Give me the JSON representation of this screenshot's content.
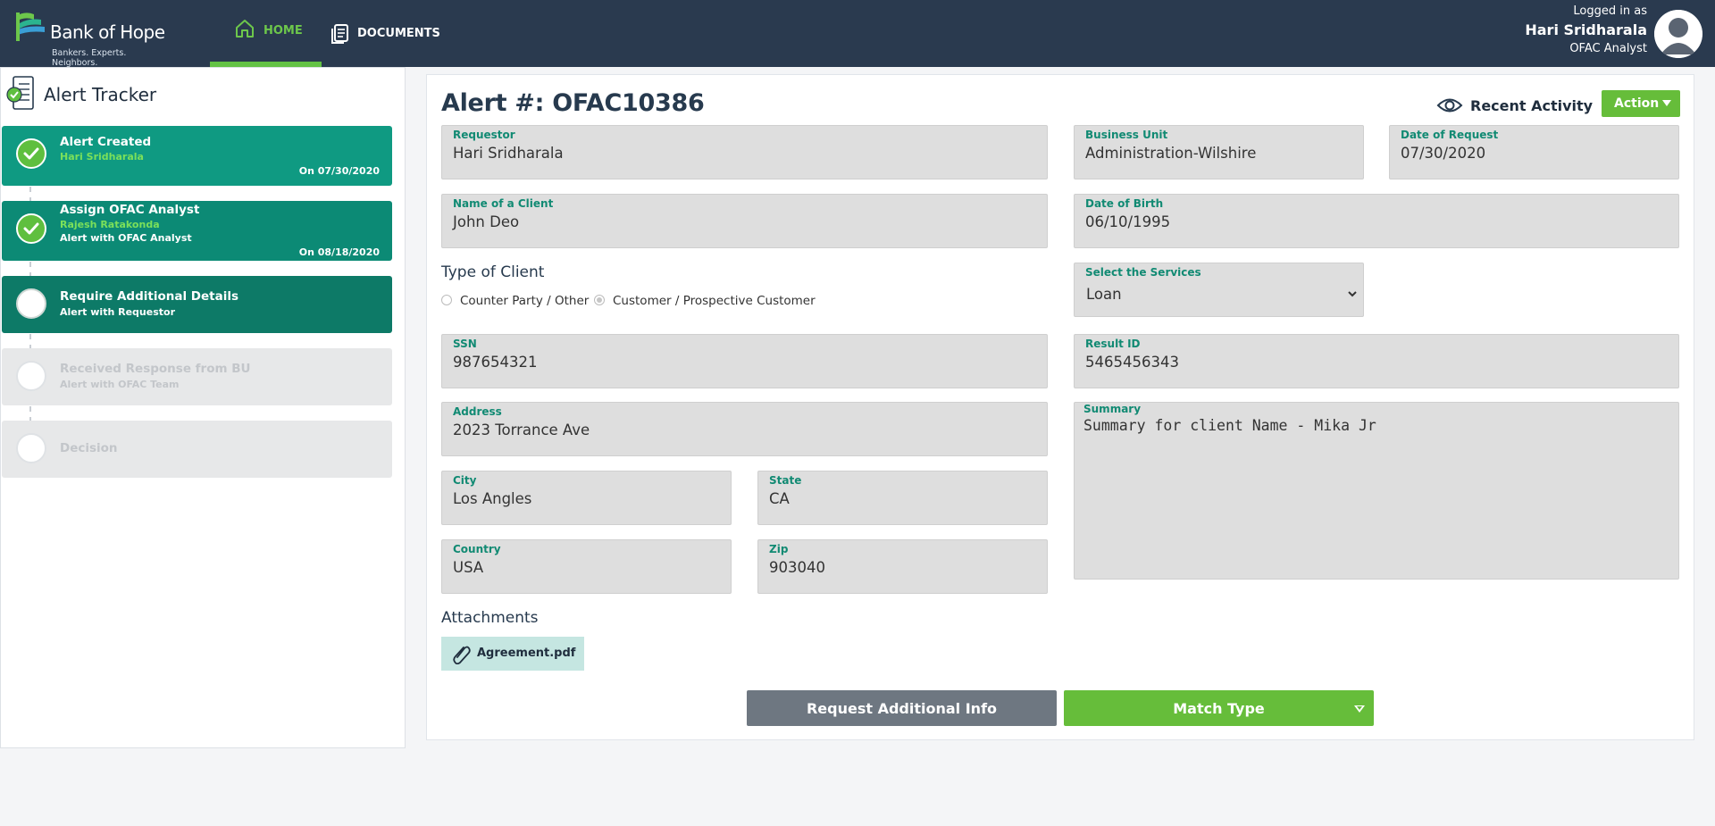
{
  "header": {
    "brand_name": "Bank of Hope",
    "brand_tagline": "Bankers. Experts. Neighbors.",
    "nav": [
      {
        "label": "HOME",
        "icon": "home-icon",
        "active": true
      },
      {
        "label": "DOCUMENTS",
        "icon": "documents-icon",
        "active": false
      }
    ],
    "user": {
      "logged_in_label": "Logged in as",
      "name": "Hari Sridharala",
      "role": "OFAC Analyst",
      "avatar_icon": "user-avatar-icon"
    }
  },
  "tracker": {
    "title": "Alert Tracker",
    "icon": "alert-tracker-icon",
    "steps": [
      {
        "title": "Alert Created",
        "person": "Hari Sridharala",
        "status": "",
        "date": "On  07/30/2020",
        "state": "done"
      },
      {
        "title": "Assign OFAC Analyst",
        "person": "Rajesh Ratakonda",
        "status": "Alert with OFAC Analyst",
        "date": "On  08/18/2020",
        "state": "done"
      },
      {
        "title": "Require Additional Details",
        "person": "",
        "status": "Alert with Requestor",
        "date": "",
        "state": "active"
      },
      {
        "title": "Received Response from BU",
        "person": "",
        "status": "Alert with OFAC Team",
        "date": "",
        "state": "pending"
      },
      {
        "title": "Decision",
        "person": "",
        "status": "",
        "date": "",
        "state": "pending"
      }
    ]
  },
  "alert": {
    "title": "Alert #: OFAC10386",
    "recent_activity": "Recent Activity",
    "action_label": "Action"
  },
  "form": {
    "requestor": {
      "label": "Requestor",
      "value": "Hari Sridharala"
    },
    "business_unit": {
      "label": "Business Unit",
      "value": "Administration-Wilshire"
    },
    "date_of_request": {
      "label": "Date of Request",
      "value": "07/30/2020"
    },
    "client_name": {
      "label": "Name of a Client",
      "value": "John Deo"
    },
    "dob": {
      "label": "Date of Birth",
      "value": "06/10/1995"
    },
    "type_of_client": {
      "label": "Type of Client",
      "options": [
        "Counter Party / Other",
        "Customer / Prospective Customer"
      ],
      "selected": "Customer / Prospective Customer"
    },
    "services": {
      "label": "Select the Services",
      "value": "Loan"
    },
    "ssn": {
      "label": "SSN",
      "value": "987654321"
    },
    "result_id": {
      "label": "Result ID",
      "value": "5465456343"
    },
    "address": {
      "label": "Address",
      "value": "2023 Torrance Ave"
    },
    "summary": {
      "label": "Summary",
      "value": "Summary for client Name - Mika Jr"
    },
    "city": {
      "label": "City",
      "value": "Los Angles"
    },
    "state": {
      "label": "State",
      "value": "CA"
    },
    "country": {
      "label": "Country",
      "value": "USA"
    },
    "zip": {
      "label": "Zip",
      "value": "903040"
    },
    "attachments_label": "Attachments",
    "attachments": [
      {
        "name": "Agreement.pdf",
        "icon": "paperclip-icon"
      }
    ]
  },
  "buttons": {
    "request_info": "Request Additional Info",
    "match_type": "Match Type"
  },
  "colors": {
    "header_bg": "#2a3a4f",
    "accent_green": "#66bd3a",
    "teal": "#0f9a82",
    "label_teal": "#118a73"
  }
}
